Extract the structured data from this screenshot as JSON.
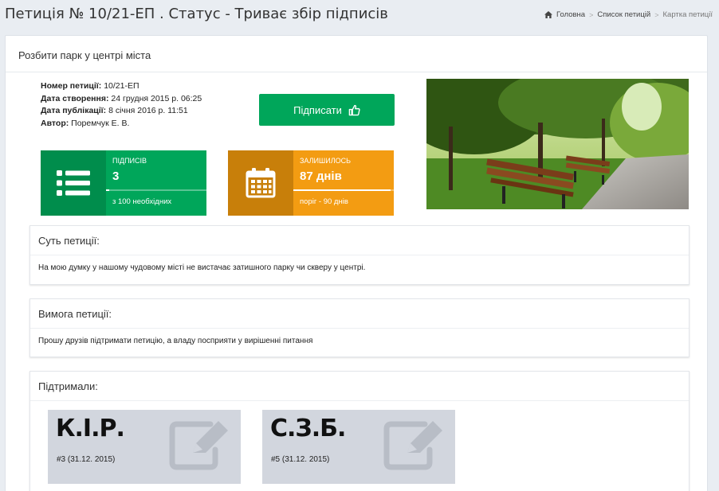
{
  "page": {
    "title": "Петиція № 10/21-ЕП . Статус - Триває збір підписів"
  },
  "breadcrumb": {
    "home": "Головна",
    "list": "Список петицій",
    "current": "Картка петиції"
  },
  "petition": {
    "name": "Розбити парк у центрі міста",
    "meta": {
      "number_label": "Номер петиції:",
      "number_value": "10/21-ЕП",
      "created_label": "Дата створення:",
      "created_value": "24 грудня 2015 р. 06:25",
      "published_label": "Дата публікації:",
      "published_value": "8 січня 2016 р. 11:51",
      "author_label": "Автор:",
      "author_value": "Поремчук Е. В."
    },
    "sign_button": "Підписати",
    "signatures_box": {
      "label": "ПІДПИСІВ",
      "value": "3",
      "sub": "з 100 необхідних",
      "progress": 0.03
    },
    "remaining_box": {
      "label": "ЗАЛИШИЛОСЬ",
      "value": "87 днів",
      "sub": "поріг - 90 днів",
      "progress": 0.97
    }
  },
  "essence": {
    "heading": "Суть петиції:",
    "text": "На мою думку у нашому чудовому місті не вистачає затишного парку чи скверу у центрі."
  },
  "demand": {
    "heading": "Вимога петиції:",
    "text": "Прошу друзів підтримати петицію, а владу посприяти у вирішенні питання"
  },
  "supporters": {
    "heading": "Підтримали:",
    "items": [
      {
        "initials": "К.І.Р.",
        "meta": "#3 (31.12. 2015)"
      },
      {
        "initials": "С.З.Б.",
        "meta": "#5 (31.12. 2015)"
      }
    ]
  },
  "colors": {
    "green": "#00a65a",
    "green_dark": "#008d4c",
    "orange": "#f39c12",
    "orange_dark": "#c87f0a",
    "card_gray": "#d2d6de"
  },
  "icons": {
    "home": "home-icon",
    "thumbs_up": "thumbs-up-icon",
    "list": "list-icon",
    "calendar": "calendar-icon",
    "edit": "edit-icon"
  }
}
